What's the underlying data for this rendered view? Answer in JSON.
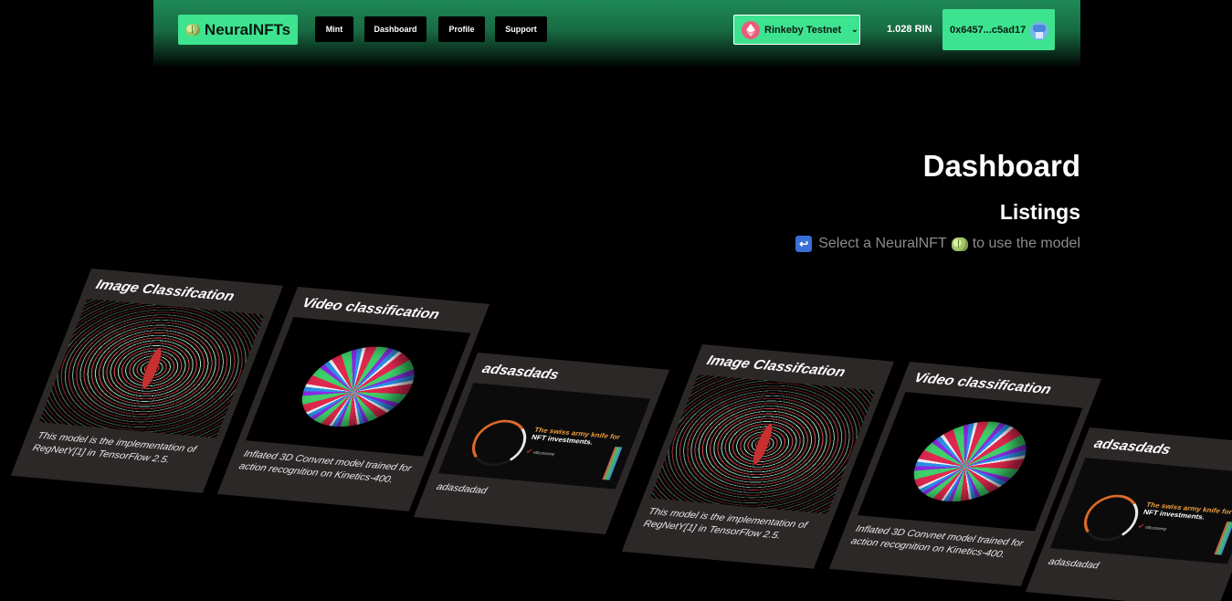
{
  "header": {
    "brand": "NeuralNFTs",
    "nav": [
      {
        "label": "Mint"
      },
      {
        "label": "Dashboard"
      },
      {
        "label": "Profile"
      },
      {
        "label": "Support"
      }
    ],
    "network": "Rinkeby Testnet",
    "balance": "1.028 RIN",
    "account": "0x6457...c5ad17"
  },
  "page": {
    "title": "Dashboard",
    "section": "Listings",
    "hint_before": "Select a NeuralNFT",
    "hint_after": "to use the model"
  },
  "listings": [
    {
      "title": "Image Classifcation",
      "description": "This model is the implementation of RegNetY[1] in TensorFlow 2.5.",
      "media": "wormhole-icon"
    },
    {
      "title": "Video classification",
      "description": "Inflated 3D Convnet model trained for action recognition on Kinetics-400.",
      "media": "egg-icon"
    },
    {
      "title": "adsasdads",
      "description": "adasdadad",
      "media": "ad-banner",
      "ad_text_highlight": "The swiss army knife for",
      "ad_text_rest": "NFT investments.",
      "ad_logo": "nftconomy"
    },
    {
      "title": "Image Classifcation",
      "description": "This model is the implementation of RegNetY[1] in TensorFlow 2.5.",
      "media": "wormhole-icon"
    },
    {
      "title": "Video classification",
      "description": "Inflated 3D Convnet model trained for action recognition on Kinetics-400.",
      "media": "egg-icon"
    },
    {
      "title": "adsasdads",
      "description": "adasdadad",
      "media": "ad-banner",
      "ad_text_highlight": "The swiss army knife for",
      "ad_text_rest": "NFT investments.",
      "ad_logo": "nftconomy"
    }
  ],
  "colors": {
    "accent": "#3ee38f",
    "card": "#2d2828",
    "muted_text": "#8b8b8b"
  }
}
